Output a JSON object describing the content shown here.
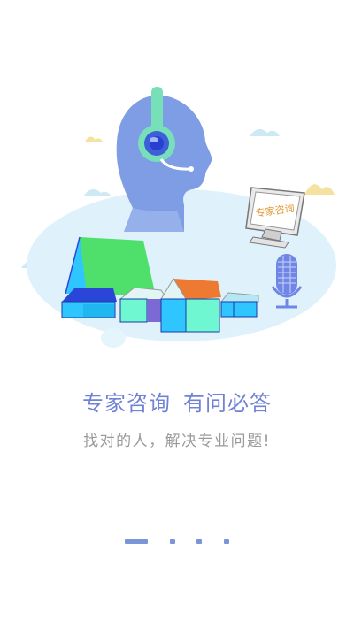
{
  "illustration": {
    "monitor_text": "专家咨询",
    "colors": {
      "bubble": "#dff2fb",
      "head": "#7f9de5",
      "headset": "#77e0b8",
      "roof_green": "#4ee06b",
      "roof_blue": "#2a46d9",
      "roof_orange": "#ee7a32",
      "wall_mint": "#6ef7d0",
      "wall_cyan": "#2fc6ff",
      "mic": "#6f86e6",
      "monitor_frame": "#e9e9e9"
    }
  },
  "onboarding": {
    "title_left": "专家咨询",
    "title_right": "有问必答",
    "subtitle": "找对的人，解决专业问题!"
  },
  "pager": {
    "total": 4,
    "active_index": 0,
    "color": "#7a96d8"
  }
}
